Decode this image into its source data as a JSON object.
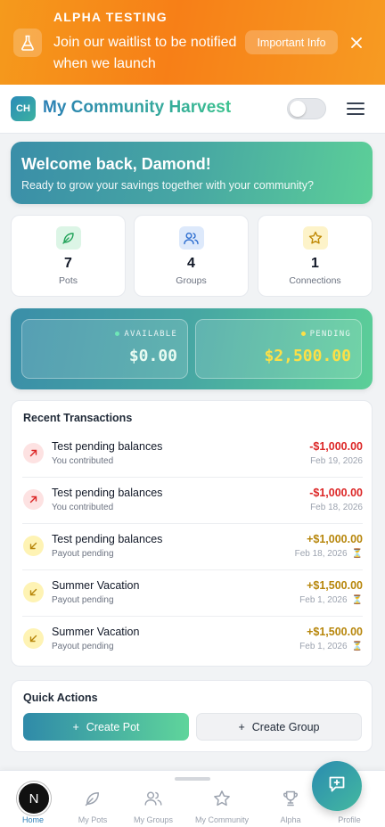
{
  "banner": {
    "tag": "ALPHA TESTING",
    "message": "Join our waitlist to be notified when we launch",
    "info_button": "Important Info"
  },
  "header": {
    "logo_initials": "CH",
    "brand": "My Community Harvest"
  },
  "welcome": {
    "title": "Welcome back, Damond!",
    "subtitle": "Ready to grow your savings together with your community?"
  },
  "stats": [
    {
      "value": "7",
      "label": "Pots",
      "icon": "leaf-icon"
    },
    {
      "value": "4",
      "label": "Groups",
      "icon": "users-icon"
    },
    {
      "value": "1",
      "label": "Connections",
      "icon": "star-icon"
    }
  ],
  "balance": {
    "available_label": "AVAILABLE",
    "available_amount": "$0.00",
    "pending_label": "PENDING",
    "pending_amount": "$2,500.00"
  },
  "transactions": {
    "title": "Recent Transactions",
    "items": [
      {
        "title": "Test pending balances",
        "subtitle": "You contributed",
        "amount": "-$1,000.00",
        "date": "Feb 19, 2026",
        "type": "out"
      },
      {
        "title": "Test pending balances",
        "subtitle": "You contributed",
        "amount": "-$1,000.00",
        "date": "Feb 18, 2026",
        "type": "out"
      },
      {
        "title": "Test pending balances",
        "subtitle": "Payout pending",
        "amount": "+$1,000.00",
        "date": "Feb 18, 2026",
        "type": "pending"
      },
      {
        "title": "Summer Vacation",
        "subtitle": "Payout pending",
        "amount": "+$1,500.00",
        "date": "Feb 1, 2026",
        "type": "pending"
      },
      {
        "title": "Summer Vacation",
        "subtitle": "Payout pending",
        "amount": "+$1,500.00",
        "date": "Feb 1, 2026",
        "type": "pending"
      }
    ]
  },
  "quick_actions": {
    "title": "Quick Actions",
    "create_pot": "Create Pot",
    "create_group": "Create Group"
  },
  "nav": {
    "home_badge": "N",
    "items": [
      "Home",
      "My Pots",
      "My Groups",
      "My Community",
      "Alpha",
      "Profile"
    ]
  },
  "colors": {
    "banner": "#f7861a",
    "brand_teal": "#3a8ea8",
    "brand_green": "#5ccf98",
    "negative": "#dc2626",
    "positive_pending": "#b7860b",
    "pending_dot": "#fde047"
  }
}
